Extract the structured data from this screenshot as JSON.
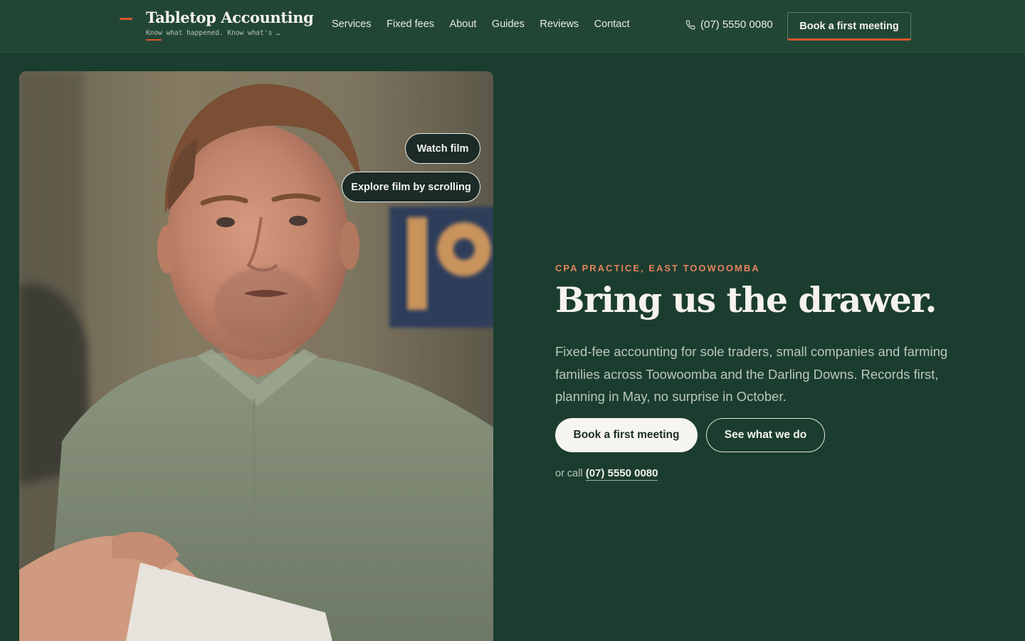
{
  "header": {
    "brand_name": "Tabletop Accounting",
    "brand_tagline": "Know what happened. Know what's n…",
    "nav": [
      "Services",
      "Fixed fees",
      "About",
      "Guides",
      "Reviews",
      "Contact"
    ],
    "phone": "(07) 5550 0080",
    "phone_icon": "phone-icon",
    "cta_label": "Book a first meeting"
  },
  "video": {
    "watch_label": "Watch film",
    "explore_label": "Explore film by scrolling"
  },
  "hero": {
    "eyebrow": "CPA PRACTICE, EAST TOOWOOMBA",
    "headline": "Bring us the drawer.",
    "lede": "Fixed-fee accounting for sole traders, small companies and farming families across Toowoomba and the Darling Downs. Records first, planning in May, no surprise in October.",
    "primary_cta": "Book a first meeting",
    "secondary_cta": "See what we do",
    "or_call_prefix": "or call",
    "or_call_phone": "(07) 5550 0080"
  },
  "colors": {
    "background": "#1b3d2f",
    "header_bg": "#224636",
    "accent": "#d9562c",
    "eyebrow": "#e4825e"
  }
}
